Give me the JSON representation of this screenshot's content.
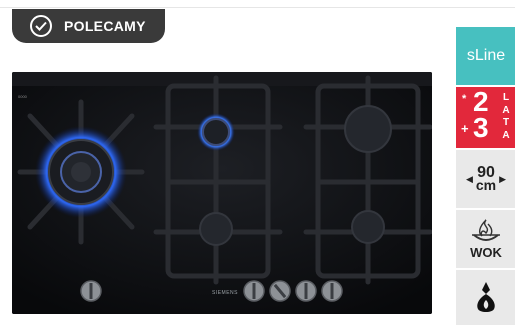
{
  "badge": {
    "label": "POLECAMY",
    "icon": "check-circle-icon"
  },
  "product_image": {
    "brand": "SIEMENS",
    "corner_mark": "0000"
  },
  "features": {
    "series": {
      "label": "sLine",
      "color": "#47c0c0"
    },
    "warranty": {
      "star": "*",
      "plus": "+",
      "years_base": "2",
      "years_extra": "3",
      "letters": [
        "L",
        "A",
        "T",
        "A"
      ],
      "color": "#e2283b"
    },
    "width": {
      "value": "90",
      "unit": "cm",
      "left_icon": "triangle-left-icon",
      "right_icon": "triangle-right-icon"
    },
    "wok": {
      "label": "WOK",
      "icon": "wok-flame-icon"
    },
    "gas": {
      "icon": "gas-drop-icon"
    }
  },
  "colors": {
    "badge_bg": "#3a3a3a",
    "tile_bg": "#e9e9e9"
  }
}
